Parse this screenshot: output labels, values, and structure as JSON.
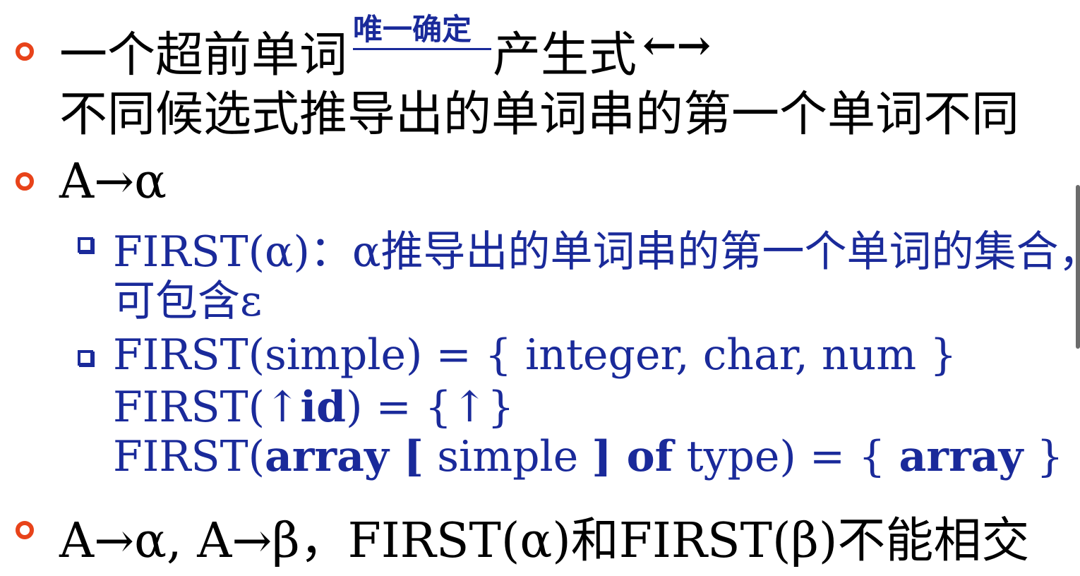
{
  "line1": {
    "part1": "一个超前单词",
    "annotation": "唯一确定",
    "part2": "产生式",
    "arrows": "←→"
  },
  "line2": "不同候选式推导出的单词串的第一个单词不同",
  "line3": "A→α",
  "sub1": {
    "line1": "FIRST(α)：α推导出的单词串的第一个单词的集合，",
    "line2": "可包含ε"
  },
  "sub2": {
    "l1": "FIRST(simple) = { integer, char, num }",
    "l2_a": "FIRST(",
    "l2_arrow": "↑",
    "l2_id": "id",
    "l2_b": ") = {↑}",
    "l3_a": "FIRST(",
    "l3_array": "array",
    "l3_lbr": " [",
    "l3_simple": " simple ",
    "l3_rbr": "]",
    "l3_of": " of",
    "l3_type": " type) = { ",
    "l3_array2": "array",
    "l3_end": " }"
  },
  "line_last": "A→α, A→β，FIRST(α)和FIRST(β)不能相交",
  "colors": {
    "bullet": "#e8431a",
    "blue": "#1a2a9a",
    "text": "#000000"
  }
}
